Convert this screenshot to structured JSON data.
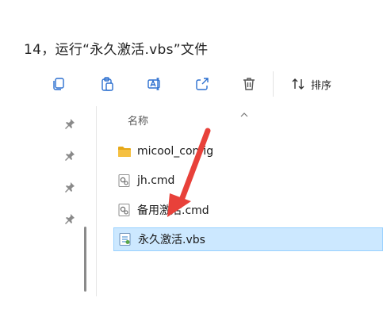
{
  "caption": "14，运行“永久激活.vbs”文件",
  "toolbar": {
    "buttons": [
      {
        "name": "copy-icon"
      },
      {
        "name": "paste-icon"
      },
      {
        "name": "rename-icon"
      },
      {
        "name": "share-icon"
      },
      {
        "name": "delete-icon"
      }
    ],
    "sort_label": "排序"
  },
  "list": {
    "column_header": "名称",
    "files": [
      {
        "name": "micool_config",
        "type": "folder",
        "icon": "folder-icon"
      },
      {
        "name": "jh.cmd",
        "type": "cmd",
        "icon": "cmd-file-icon"
      },
      {
        "name": "备用激活.cmd",
        "type": "cmd",
        "icon": "cmd-file-icon"
      },
      {
        "name": "永久激活.vbs",
        "type": "vbs",
        "icon": "vbs-file-icon",
        "selected": true
      }
    ]
  },
  "annotation": {
    "color": "#e8413a"
  },
  "colors": {
    "selection_bg": "#cce8ff",
    "selection_border": "#99d1ff",
    "folder": "#f5c042",
    "icon_accent": "#2b6fcf"
  }
}
